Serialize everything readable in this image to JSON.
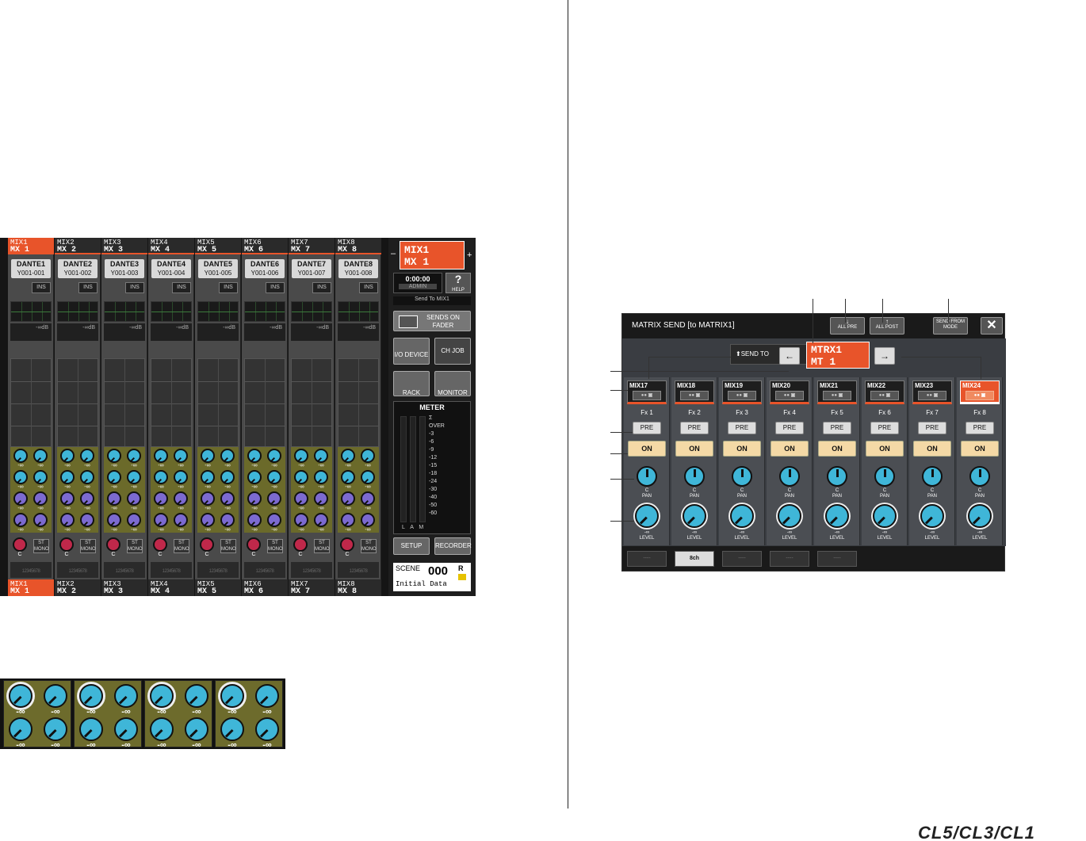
{
  "console": {
    "channels": [
      {
        "top_id": "MIX1",
        "top_name": "MX 1",
        "patch": "DANTE1",
        "patch_sub": "Y001-001",
        "bot_id": "MIX1",
        "bot_name": "MX 1"
      },
      {
        "top_id": "MIX2",
        "top_name": "MX 2",
        "patch": "DANTE2",
        "patch_sub": "Y001-002",
        "bot_id": "MIX2",
        "bot_name": "MX 2"
      },
      {
        "top_id": "MIX3",
        "top_name": "MX 3",
        "patch": "DANTE3",
        "patch_sub": "Y001-003",
        "bot_id": "MIX3",
        "bot_name": "MX 3"
      },
      {
        "top_id": "MIX4",
        "top_name": "MX 4",
        "patch": "DANTE4",
        "patch_sub": "Y001-004",
        "bot_id": "MIX4",
        "bot_name": "MX 4"
      },
      {
        "top_id": "MIX5",
        "top_name": "MX 5",
        "patch": "DANTE5",
        "patch_sub": "Y001-005",
        "bot_id": "MIX5",
        "bot_name": "MX 5"
      },
      {
        "top_id": "MIX6",
        "top_name": "MX 6",
        "patch": "DANTE6",
        "patch_sub": "Y001-006",
        "bot_id": "MIX6",
        "bot_name": "MX 6"
      },
      {
        "top_id": "MIX7",
        "top_name": "MX 7",
        "patch": "DANTE7",
        "patch_sub": "Y001-007",
        "bot_id": "MIX7",
        "bot_name": "MX 7"
      },
      {
        "top_id": "MIX8",
        "top_name": "MX 8",
        "patch": "DANTE8",
        "patch_sub": "Y001-008",
        "bot_id": "MIX8",
        "bot_name": "MX 8"
      }
    ],
    "ins_label": "INS",
    "dyn_label": "-∞dB",
    "knob_value": "-∞",
    "pan_value": "C",
    "st_label": "ST",
    "mono_label": "MONO",
    "bus_numbers": "12345678",
    "selected": {
      "line1": "MIX1",
      "line2": "MX 1"
    },
    "time": "0:00:00",
    "user": "ADMIN",
    "help": "HELP",
    "send_to": "Send To MIX1",
    "sends_on_fader": "SENDS ON FADER",
    "io_device": "I/O DEVICE",
    "ch_job": "CH JOB",
    "rack": "RACK",
    "monitor": "MONITOR",
    "meter_title": "METER",
    "meter_scale": [
      "Σ",
      "OVER",
      "-3",
      "-6",
      "-9",
      "-12",
      "-15",
      "-18",
      "-24",
      "-30",
      "-40",
      "-50",
      "-60"
    ],
    "meter_lam": "L  A  M",
    "setup": "SETUP",
    "recorder": "RECORDER",
    "scene_label": "SCENE",
    "scene_number": "000",
    "scene_r": "R",
    "scene_name": "Initial Data"
  },
  "inset": {
    "value": "-∞"
  },
  "popup": {
    "title": "MATRIX SEND [to MATRIX1]",
    "all_pre": "ALL PRE",
    "all_post": "ALL POST",
    "send_from_mode": "SEND FROM MODE",
    "close": "✕",
    "send_to_label": "⬆SEND TO",
    "left_arrow": "←",
    "right_arrow": "→",
    "target_line1": "MTRX1",
    "target_line2": "MT 1",
    "channels": [
      {
        "id": "MIX17",
        "fx": "Fx 1"
      },
      {
        "id": "MIX18",
        "fx": "Fx 2"
      },
      {
        "id": "MIX19",
        "fx": "Fx 3"
      },
      {
        "id": "MIX20",
        "fx": "Fx 4"
      },
      {
        "id": "MIX21",
        "fx": "Fx 5"
      },
      {
        "id": "MIX22",
        "fx": "Fx 6"
      },
      {
        "id": "MIX23",
        "fx": "Fx 7"
      },
      {
        "id": "MIX24",
        "fx": "Fx 8"
      }
    ],
    "pre_label": "PRE",
    "on_label": "ON",
    "pan_value": "C",
    "pan_label": "PAN",
    "level_value": "-∞",
    "level_label": "LEVEL",
    "bottom_tabs": [
      "----",
      "8ch",
      "----",
      "----",
      "----"
    ]
  },
  "brand": "CL5/CL3/CL1"
}
